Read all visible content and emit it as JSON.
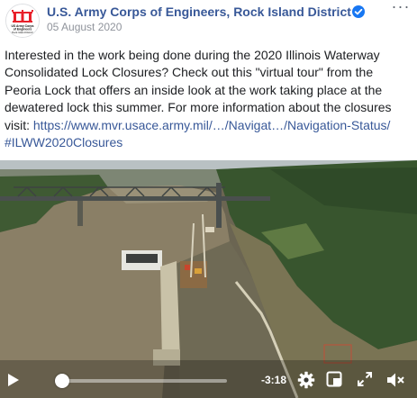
{
  "post": {
    "page_name": "U.S. Army Corps of Engineers, Rock Island District",
    "date": "05 August 2020",
    "body_text": "Interested in the work being done during the 2020 Illinois Waterway Consolidated Lock Closures? Check out this \"virtual tour\" from the Peoria Lock that offers an inside look at the work taking place at the dewatered lock this summer. For more information about the closures visit: ",
    "link_text": "https://www.mvr.usace.army.mil/…/Navigat…/Navigation-Status/",
    "hashtag": "#ILWW2020Closures",
    "more_label": "···"
  },
  "avatar": {
    "lines": [
      "US Army Corps",
      "of Engineers",
      "Rock Island District"
    ]
  },
  "video": {
    "time_remaining": "-3:18",
    "progress_percent": 2
  },
  "colors": {
    "link": "#385898",
    "verified": "#1877f2",
    "muted": "#90949c"
  },
  "icons": {
    "verified": "verified-badge-icon",
    "play": "play-icon",
    "settings": "gear-icon",
    "pip": "picture-in-picture-icon",
    "fullscreen": "fullscreen-icon",
    "volume": "volume-muted-icon"
  }
}
